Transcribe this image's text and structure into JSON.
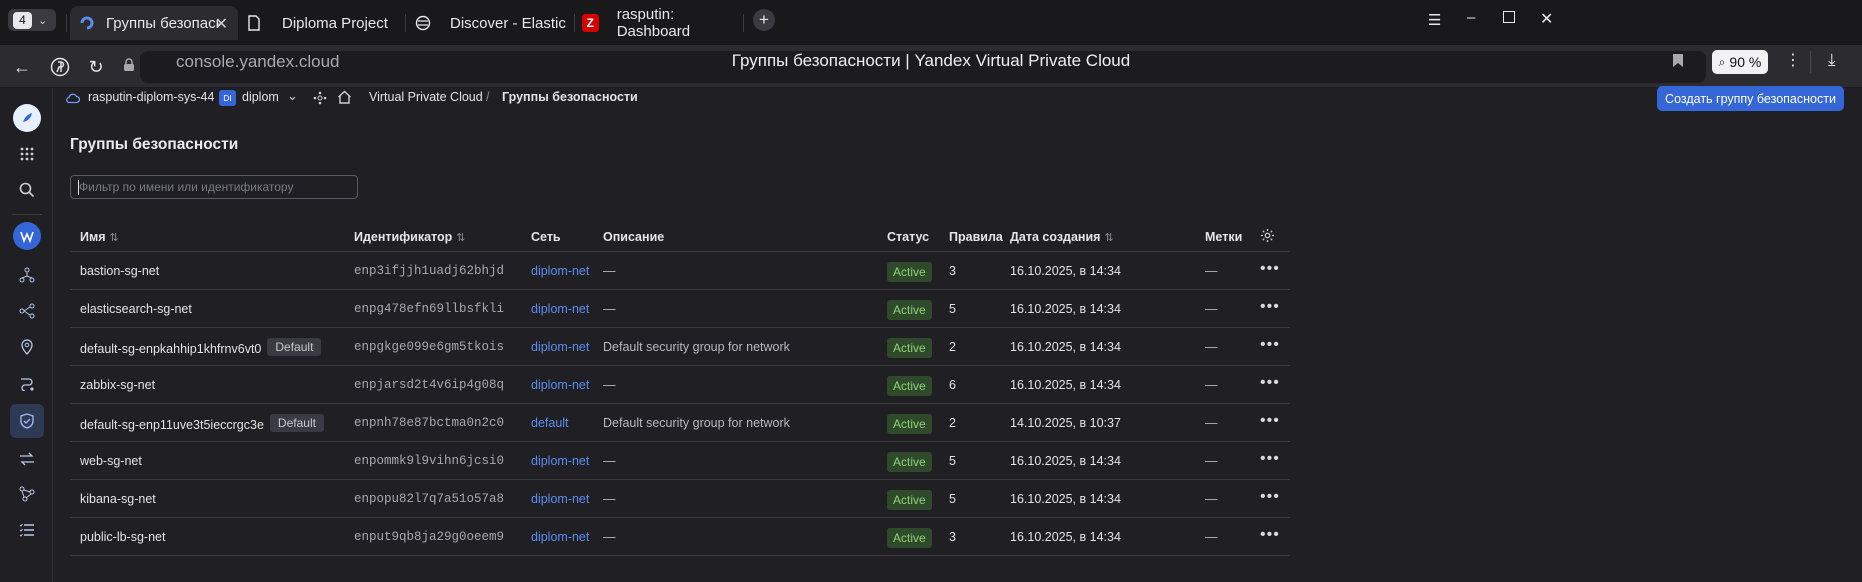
{
  "browser": {
    "tab_counter": "4",
    "tabs": [
      {
        "title": "Группы безопасности | Yandex",
        "active": true
      },
      {
        "title": "Diploma Project",
        "active": false
      },
      {
        "title": "Discover - Elastic",
        "active": false
      },
      {
        "title": "rasputin: Dashboard",
        "active": false
      }
    ],
    "url": "console.yandex.cloud",
    "page_title": "Группы безопасности | Yandex Virtual Private Cloud",
    "zoom": "90 %"
  },
  "breadcrumbs": {
    "cloud": "rasputin-diplom-sys-44",
    "folder_badge": "DI",
    "folder": "diplom",
    "service": "Virtual Private Cloud",
    "separator": "/",
    "current": "Группы безопасности"
  },
  "actions": {
    "create_label": "Создать группу безопасности"
  },
  "main": {
    "title": "Группы безопасности",
    "filter_placeholder": "Фильтр по имени или идентификатору"
  },
  "table": {
    "columns": {
      "name": "Имя",
      "id": "Идентификатор",
      "network": "Сеть",
      "description": "Описание",
      "status": "Статус",
      "rules": "Правила",
      "created": "Дата создания",
      "labels": "Метки"
    },
    "rows": [
      {
        "name": "bastion-sg-net",
        "default": "",
        "id": "enp3ifjjh1uadj62bhjd",
        "network": "diplom-net",
        "description": "—",
        "status": "Active",
        "rules": "3",
        "created": "16.10.2025, в 14:34",
        "labels": "—"
      },
      {
        "name": "elasticsearch-sg-net",
        "default": "",
        "id": "enpg478efn69llbsfkli",
        "network": "diplom-net",
        "description": "—",
        "status": "Active",
        "rules": "5",
        "created": "16.10.2025, в 14:34",
        "labels": "—"
      },
      {
        "name": "default-sg-enpkahhip1khfrnv6vt0",
        "default": "Default",
        "id": "enpgkge099e6gm5tkois",
        "network": "diplom-net",
        "description": "Default security group for network",
        "status": "Active",
        "rules": "2",
        "created": "16.10.2025, в 14:34",
        "labels": "—"
      },
      {
        "name": "zabbix-sg-net",
        "default": "",
        "id": "enpjarsd2t4v6ip4g08q",
        "network": "diplom-net",
        "description": "—",
        "status": "Active",
        "rules": "6",
        "created": "16.10.2025, в 14:34",
        "labels": "—"
      },
      {
        "name": "default-sg-enp11uve3t5ieccrgc3e",
        "default": "Default",
        "id": "enpnh78e87bctma0n2c0",
        "network": "default",
        "description": "Default security group for network",
        "status": "Active",
        "rules": "2",
        "created": "14.10.2025, в 10:37",
        "labels": "—"
      },
      {
        "name": "web-sg-net",
        "default": "",
        "id": "enpommk9l9vihn6jcsi0",
        "network": "diplom-net",
        "description": "—",
        "status": "Active",
        "rules": "5",
        "created": "16.10.2025, в 14:34",
        "labels": "—"
      },
      {
        "name": "kibana-sg-net",
        "default": "",
        "id": "enpopu82l7q7a51o57a8",
        "network": "diplom-net",
        "description": "—",
        "status": "Active",
        "rules": "5",
        "created": "16.10.2025, в 14:34",
        "labels": "—"
      },
      {
        "name": "public-lb-sg-net",
        "default": "",
        "id": "enput9qb8ja29g0oeem9",
        "network": "diplom-net",
        "description": "—",
        "status": "Active",
        "rules": "3",
        "created": "16.10.2025, в 14:34",
        "labels": "—"
      }
    ]
  },
  "colors": {
    "accent": "#3566d8",
    "link": "#5b8def",
    "status_active_bg": "#2f4a2a",
    "status_active_fg": "#8fd17a"
  }
}
